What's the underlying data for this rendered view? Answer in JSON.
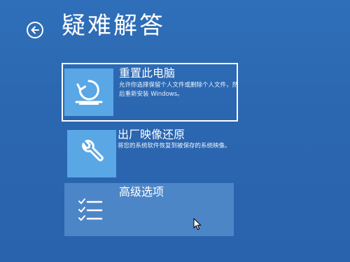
{
  "header": {
    "back_icon": "back-arrow-circle-icon",
    "title": "疑难解答"
  },
  "options": [
    {
      "title": "重置此电脑",
      "description": "允许你选择保留个人文件或删除个人文件，然后重新安装 Windows。",
      "icon": "reset-pc-icon",
      "state": "selected"
    },
    {
      "title": "出厂映像还原",
      "description": "将您的系统软件恢复到被保存的系统映像。",
      "icon": "wrench-icon",
      "state": "normal"
    },
    {
      "title": "高级选项",
      "description": "",
      "icon": "checklist-icon",
      "state": "hovered"
    }
  ],
  "colors": {
    "background": "#2b66b0",
    "tile": "#5aa7e6",
    "text": "#ffffff"
  },
  "pointer_icon": "mouse-pointer-icon"
}
